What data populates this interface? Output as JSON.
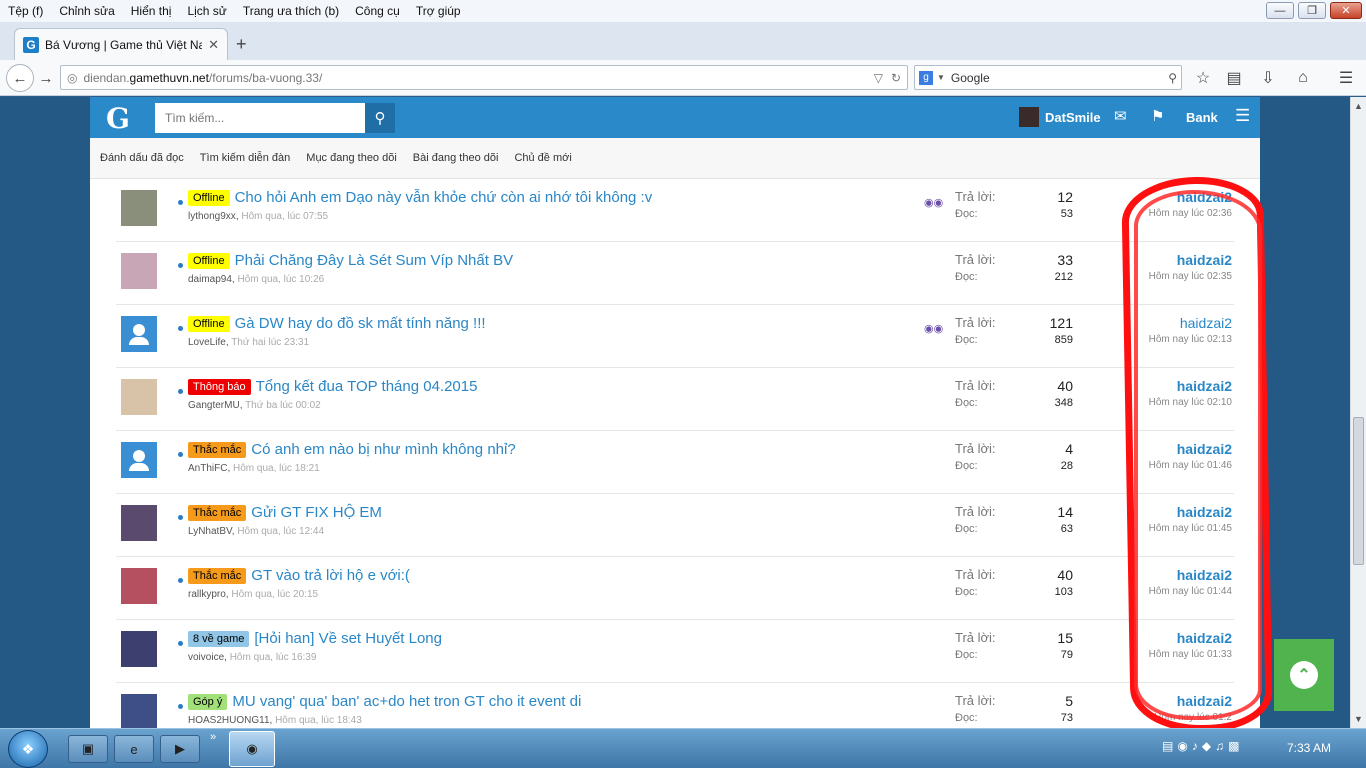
{
  "menubar": {
    "items": [
      "Tệp (f)",
      "Chỉnh sửa",
      "Hiển thị",
      "Lịch sử",
      "Trang ưa thích (b)",
      "Công cụ",
      "Trợ giúp"
    ]
  },
  "tab": {
    "title": "Bá Vương | Game thủ Việt Na...",
    "favicon": "G"
  },
  "url": {
    "prefix": "diendan.",
    "domain": "gamethuvn.net",
    "path": "/forums/ba-vuong.33/"
  },
  "search": {
    "placeholder": "Google"
  },
  "site": {
    "logo": "G",
    "search_placeholder": "Tìm kiếm...",
    "username": "DatSmile",
    "bank": "Bank",
    "subnav": [
      "Đánh dấu đã đọc",
      "Tìm kiếm diễn đàn",
      "Mục đang theo dõi",
      "Bài đang theo dõi",
      "Chủ đề mới"
    ]
  },
  "labels": {
    "replies": "Trả lời:",
    "views": "Đọc:"
  },
  "threads": [
    {
      "prefix": "Offline",
      "prefix_type": "offline",
      "title": "Cho hỏi Anh em Dạo này vẫn khỏe chứ còn ai nhớ tôi không :v",
      "author": "lythong9xx",
      "date": "Hôm qua, lúc 07:55",
      "replies": "12",
      "views": "53",
      "last_user": "haidzai2",
      "last_time": "Hôm nay lúc 02:36",
      "eye": true,
      "avatar": "photo"
    },
    {
      "prefix": "Offline",
      "prefix_type": "offline",
      "title": "Phải Chăng Đây Là Sét Sum Víp Nhất BV",
      "author": "daimap94",
      "date": "Hôm qua, lúc 10:26",
      "replies": "33",
      "views": "212",
      "last_user": "haidzai2",
      "last_time": "Hôm nay lúc 02:35",
      "eye": false,
      "avatar": "photo"
    },
    {
      "prefix": "Offline",
      "prefix_type": "offline",
      "title": "Gà DW hay do đồ sk mất tính năng !!!",
      "author": "LoveLife",
      "date": "Thứ hai lúc 23:31",
      "replies": "121",
      "views": "859",
      "last_user": "haidzai2",
      "last_time": "Hôm nay lúc 02:13",
      "eye": true,
      "avatar": "default",
      "read": true
    },
    {
      "prefix": "Thông báo",
      "prefix_type": "thongbao",
      "title": "Tổng kết đua TOP tháng 04.2015",
      "author": "GangterMU",
      "date": "Thứ ba lúc 00:02",
      "replies": "40",
      "views": "348",
      "last_user": "haidzai2",
      "last_time": "Hôm nay lúc 02:10",
      "eye": false,
      "avatar": "photo"
    },
    {
      "prefix": "Thắc mắc",
      "prefix_type": "thacmac",
      "title": "Có anh em nào bị như mình không nhỉ?",
      "author": "AnThiFC",
      "date": "Hôm qua, lúc 18:21",
      "replies": "4",
      "views": "28",
      "last_user": "haidzai2",
      "last_time": "Hôm nay lúc 01:46",
      "eye": false,
      "avatar": "default"
    },
    {
      "prefix": "Thắc mắc",
      "prefix_type": "thacmac",
      "title": "Gửi GT FIX HỘ EM",
      "author": "LyNhatBV",
      "date": "Hôm qua, lúc 12:44",
      "replies": "14",
      "views": "63",
      "last_user": "haidzai2",
      "last_time": "Hôm nay lúc 01:45",
      "eye": false,
      "avatar": "photo"
    },
    {
      "prefix": "Thắc mắc",
      "prefix_type": "thacmac",
      "title": "GT vào trả lời hộ e với:(",
      "author": "rallkypro",
      "date": "Hôm qua, lúc 20:15",
      "replies": "40",
      "views": "103",
      "last_user": "haidzai2",
      "last_time": "Hôm nay lúc 01:44",
      "eye": false,
      "avatar": "photo"
    },
    {
      "prefix": "8 về game",
      "prefix_type": "veg",
      "title": "[Hỏi han] Về set Huyết Long",
      "author": "voivoice",
      "date": "Hôm qua, lúc 16:39",
      "replies": "15",
      "views": "79",
      "last_user": "haidzai2",
      "last_time": "Hôm nay lúc 01:33",
      "eye": false,
      "avatar": "photo"
    },
    {
      "prefix": "Góp ý",
      "prefix_type": "gopy",
      "title": "MU vang' qua' ban' ac+do het tron GT cho it event di",
      "author": "HOAS2HUONG11",
      "date": "Hôm qua, lúc 18:43",
      "replies": "5",
      "views": "73",
      "last_user": "haidzai2",
      "last_time": "Hôm nay lúc 01:2",
      "eye": false,
      "avatar": "photo"
    }
  ],
  "taskbar": {
    "clock": "7:33 AM"
  },
  "colors": {
    "link": "#2a87c7",
    "header": "#2a89c9",
    "annotation": "#ff1010",
    "totop": "#50b34e"
  }
}
